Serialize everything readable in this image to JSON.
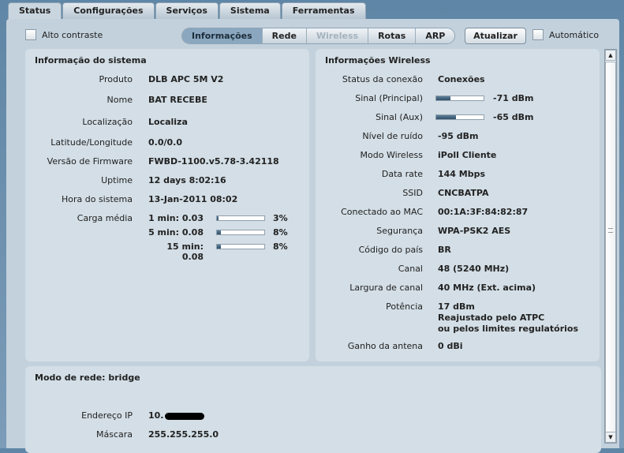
{
  "tabs": [
    "Status",
    "Configurações",
    "Serviços",
    "Sistema",
    "Ferramentas"
  ],
  "toolbar": {
    "high_contrast": "Alto contraste",
    "subtabs": [
      "Informações",
      "Rede",
      "Wireless",
      "Rotas",
      "ARP"
    ],
    "refresh": "Atualizar",
    "auto": "Automático"
  },
  "system": {
    "title": "Informação do sistema",
    "rows": [
      {
        "k": "Produto",
        "v": "DLB APC 5M V2"
      },
      {
        "k": "Nome",
        "v": "BAT RECEBE"
      },
      {
        "k": "Localização",
        "v": "Localiza"
      },
      {
        "k": "Latitude/Longitude",
        "v": "0.0/0.0"
      },
      {
        "k": "Versão de Firmware",
        "v": "FWBD-1100.v5.78-3.42118"
      },
      {
        "k": "Uptime",
        "v": "12 days 8:02:16"
      },
      {
        "k": "Hora do sistema",
        "v": "13-Jan-2011 08:02"
      }
    ],
    "load_label": "Carga média",
    "load": [
      {
        "k": "1 min: 0.03",
        "pct": 3,
        "t": "3%"
      },
      {
        "k": "5 min: 0.08",
        "pct": 8,
        "t": "8%"
      },
      {
        "k": "15 min: 0.08",
        "pct": 8,
        "t": "8%"
      }
    ]
  },
  "wireless": {
    "title": "Informações Wireless",
    "rows": [
      {
        "k": "Status da conexão",
        "v": "Conexões"
      },
      {
        "k": "Sinal (Principal)",
        "v": "-71 dBm",
        "bar": 30
      },
      {
        "k": "Sinal (Aux)",
        "v": "-65 dBm",
        "bar": 42
      },
      {
        "k": "Nível de ruído",
        "v": "-95 dBm"
      },
      {
        "k": "Modo Wireless",
        "v": "iPoll Cliente"
      },
      {
        "k": "Data rate",
        "v": "144 Mbps"
      },
      {
        "k": "SSID",
        "v": "CNCBATPA"
      },
      {
        "k": "Conectado ao MAC",
        "v": "00:1A:3F:84:82:87"
      },
      {
        "k": "Segurança",
        "v": "WPA-PSK2 AES"
      },
      {
        "k": "Código do país",
        "v": "BR"
      },
      {
        "k": "Canal",
        "v": "48 (5240 MHz)"
      },
      {
        "k": "Largura de canal",
        "v": "40 MHz (Ext. acima)"
      },
      {
        "k": "Potência",
        "v": "17 dBm",
        "v2": "Reajustado pelo ATPC",
        "v3": "ou pelos limites regulatórios"
      },
      {
        "k": "Ganho da antena",
        "v": "0 dBi"
      }
    ]
  },
  "network": {
    "title": "Modo de rede: bridge",
    "ip_label": "Endereço IP",
    "ip_prefix": "10.",
    "mask_label": "Máscara",
    "mask": "255.255.255.0"
  }
}
